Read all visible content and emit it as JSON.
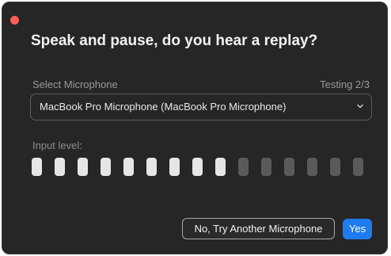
{
  "dialog": {
    "title": "Speak and pause, do you hear a replay?",
    "mic_label": "Select Microphone",
    "testing_status": "Testing 2/3",
    "selected_microphone": "MacBook Pro Microphone (MacBook Pro Microphone)",
    "input_level_label": "Input level:"
  },
  "input_level": {
    "total_segments": 15,
    "active_segments": 9,
    "active_color": "#e6e6e6",
    "inactive_color": "#5a5a5a"
  },
  "buttons": {
    "try_another": "No, Try Another Microphone",
    "yes": "Yes"
  },
  "colors": {
    "background": "#262626",
    "accent": "#1e7cf0",
    "close": "#ff5f57"
  }
}
